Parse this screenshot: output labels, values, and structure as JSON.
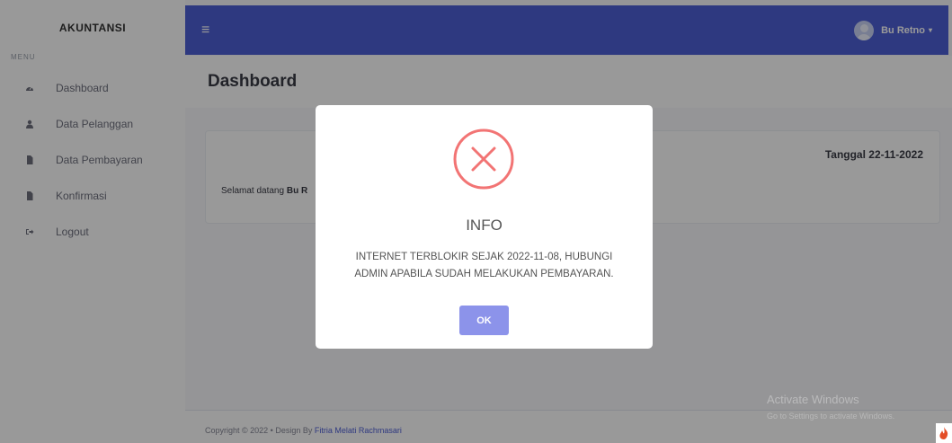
{
  "sidebar": {
    "brand": "AKUNTANSI",
    "menu_heading": "MENU",
    "items": [
      {
        "label": "Dashboard",
        "icon": "tachometer-icon"
      },
      {
        "label": "Data Pelanggan",
        "icon": "user-icon"
      },
      {
        "label": "Data Pembayaran",
        "icon": "file-icon"
      },
      {
        "label": "Konfirmasi",
        "icon": "file-icon"
      },
      {
        "label": "Logout",
        "icon": "sign-out-icon"
      }
    ]
  },
  "topbar": {
    "menu_icon": "≡",
    "user_name": "Bu Retno",
    "caret": "▾"
  },
  "main": {
    "page_title": "Dashboard",
    "date_label": "Tanggal 22-11-2022",
    "welcome_prefix": "Selamat datang",
    "welcome_name": "Bu R"
  },
  "footer": {
    "text": "Copyright © 2022  •  Design By",
    "author": "Fitria Melati Rachmasari"
  },
  "watermark": {
    "line1": "Activate Windows",
    "line2": "Go to Settings to activate Windows."
  },
  "modal": {
    "title": "INFO",
    "message_line1": "INTERNET TERBLOKIR SEJAK 2022-11-08, HUBUNGI",
    "message_line2": "ADMIN APABILA SUDAH MELAKUKAN PEMBAYARAN.",
    "ok_label": "OK"
  },
  "colors": {
    "topbar": "#4e5fd6",
    "error": "#f27474",
    "ok_button": "#8c93ea"
  }
}
